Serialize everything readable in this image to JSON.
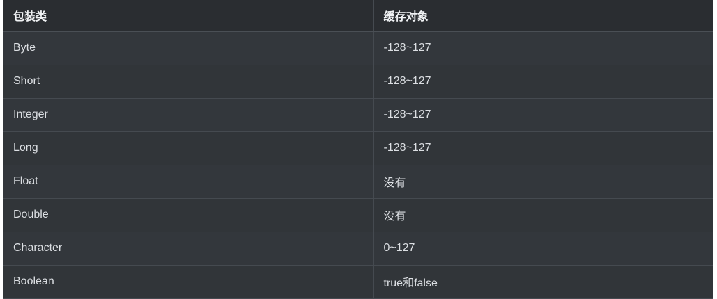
{
  "table": {
    "headers": [
      "包装类",
      "缓存对象"
    ],
    "rows": [
      {
        "type": "Byte",
        "cache": "-128~127"
      },
      {
        "type": "Short",
        "cache": "-128~127"
      },
      {
        "type": "Integer",
        "cache": "-128~127"
      },
      {
        "type": "Long",
        "cache": "-128~127"
      },
      {
        "type": "Float",
        "cache": "没有"
      },
      {
        "type": "Double",
        "cache": "没有"
      },
      {
        "type": "Character",
        "cache": "0~127"
      },
      {
        "type": "Boolean",
        "cache": "true和false"
      }
    ]
  },
  "colors": {
    "table_background": "#2f3337",
    "header_background": "#2a2d31",
    "grid_line": "#454a50",
    "text": "#dcdfe3"
  }
}
